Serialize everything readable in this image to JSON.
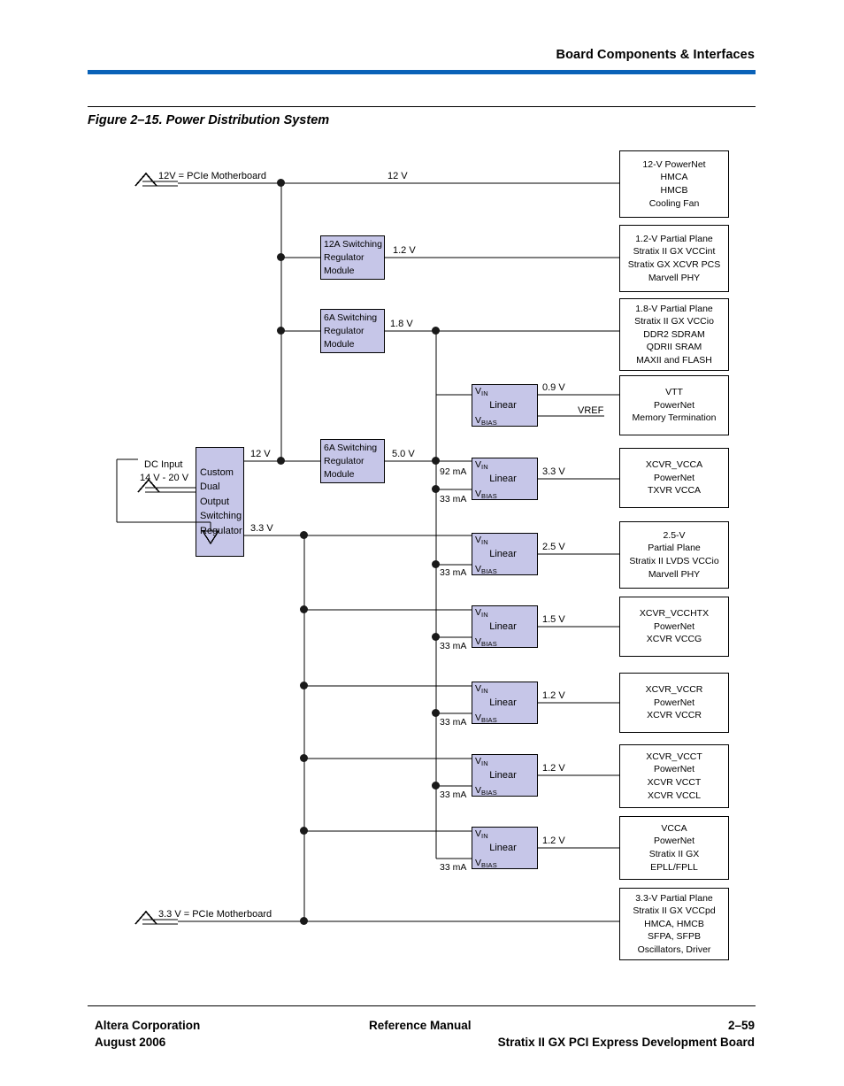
{
  "header": {
    "title": "Board Components & Interfaces",
    "rule_color": "#0a62b8"
  },
  "figure": {
    "caption": "Figure 2–15. Power Distribution System"
  },
  "footer": {
    "left_line1": "Altera Corporation",
    "left_line2": "August 2006",
    "middle": "Reference Manual",
    "right_line1": "2–59",
    "right_line2": "Stratix II GX PCI Express Development Board"
  },
  "diagram": {
    "sources": [
      {
        "id": "src-12v",
        "label": "12V = PCIe Motherboard"
      },
      {
        "id": "src-33v",
        "label": "3.3 V = PCIe Motherboard"
      }
    ],
    "dc_input": {
      "title": "DC Input",
      "range": "14 V - 20 V"
    },
    "custom_regulator": {
      "lines": [
        "Custom",
        "Dual",
        "Output",
        "Switching",
        "Regulator"
      ],
      "out_12v": "12 V",
      "out_33v": "3.3 V"
    },
    "switching_modules": [
      {
        "id": "sw-12a",
        "lines": [
          "12A Switching",
          "Regulator",
          "Module"
        ],
        "out": "1.2 V"
      },
      {
        "id": "sw-6a-18",
        "lines": [
          "6A Switching",
          "Regulator",
          "Module"
        ],
        "out": "1.8 V"
      },
      {
        "id": "sw-6a-50",
        "lines": [
          "6A Switching",
          "Regulator",
          "Module"
        ],
        "out": "5.0 V"
      }
    ],
    "linear_regulators": [
      {
        "id": "lin-09",
        "vin": "V",
        "vin_sub": "IN",
        "name": "Linear",
        "vbias": "V",
        "vbias_sub": "BIAS",
        "out": "0.9 V",
        "aux": "VREF",
        "bias_current": ""
      },
      {
        "id": "lin-33",
        "vin": "V",
        "vin_sub": "IN",
        "name": "Linear",
        "vbias": "V",
        "vbias_sub": "BIAS",
        "out": "3.3 V",
        "in_current": "92 mA",
        "bias_current": "33 mA"
      },
      {
        "id": "lin-25",
        "vin": "V",
        "vin_sub": "IN",
        "name": "Linear",
        "vbias": "V",
        "vbias_sub": "BIAS",
        "out": "2.5 V",
        "bias_current": "33 mA"
      },
      {
        "id": "lin-15",
        "vin": "V",
        "vin_sub": "IN",
        "name": "Linear",
        "vbias": "V",
        "vbias_sub": "BIAS",
        "out": "1.5 V",
        "bias_current": "33 mA"
      },
      {
        "id": "lin-12r",
        "vin": "V",
        "vin_sub": "IN",
        "name": "Linear",
        "vbias": "V",
        "vbias_sub": "BIAS",
        "out": "1.2 V",
        "bias_current": "33 mA"
      },
      {
        "id": "lin-12t",
        "vin": "V",
        "vin_sub": "IN",
        "name": "Linear",
        "vbias": "V",
        "vbias_sub": "BIAS",
        "out": "1.2 V",
        "bias_current": "33 mA"
      },
      {
        "id": "lin-12a",
        "vin": "V",
        "vin_sub": "IN",
        "name": "Linear",
        "vbias": "V",
        "vbias_sub": "BIAS",
        "out": "1.2 V",
        "bias_current": "33 mA"
      }
    ],
    "rail_labels": {
      "r12v": "12 V",
      "r12v_custom": "12 V",
      "r33v_custom": "3.3 V"
    },
    "loads": [
      {
        "id": "load-12v",
        "lines": [
          "12-V PowerNet",
          "HMCA",
          "HMCB",
          "Cooling Fan"
        ]
      },
      {
        "id": "load-12",
        "lines": [
          "1.2-V Partial Plane",
          "Stratix II GX VCCint",
          "Stratix GX XCVR PCS",
          "Marvell PHY"
        ]
      },
      {
        "id": "load-18",
        "lines": [
          "1.8-V Partial Plane",
          "Stratix II GX VCCio",
          "DDR2 SDRAM",
          "QDRII SRAM",
          "MAXII and FLASH"
        ]
      },
      {
        "id": "load-vtt",
        "lines": [
          "VTT",
          "PowerNet",
          "Memory Termination"
        ]
      },
      {
        "id": "load-vcca",
        "lines": [
          "XCVR_VCCA",
          "PowerNet",
          "TXVR VCCA"
        ]
      },
      {
        "id": "load-25",
        "lines": [
          "2.5-V",
          "Partial Plane",
          "Stratix II LVDS VCCio",
          "Marvell PHY"
        ]
      },
      {
        "id": "load-vcchtx",
        "lines": [
          "XCVR_VCCHTX",
          "PowerNet",
          "XCVR VCCG"
        ]
      },
      {
        "id": "load-vccr",
        "lines": [
          "XCVR_VCCR",
          "PowerNet",
          "XCVR VCCR"
        ]
      },
      {
        "id": "load-vcct",
        "lines": [
          "XCVR_VCCT",
          "PowerNet",
          "XCVR VCCT",
          "XCVR VCCL"
        ]
      },
      {
        "id": "load-epll",
        "lines": [
          "VCCA",
          "PowerNet",
          "Stratix II GX",
          "EPLL/FPLL"
        ]
      },
      {
        "id": "load-33",
        "lines": [
          "3.3-V Partial Plane",
          "Stratix II GX VCCpd",
          "HMCA, HMCB",
          "SFPA, SFPB",
          "Oscillators, Driver"
        ]
      }
    ],
    "colors": {
      "block_fill": "#c6c6e8",
      "wire": "#000000",
      "accent": "#0a62b8"
    }
  }
}
